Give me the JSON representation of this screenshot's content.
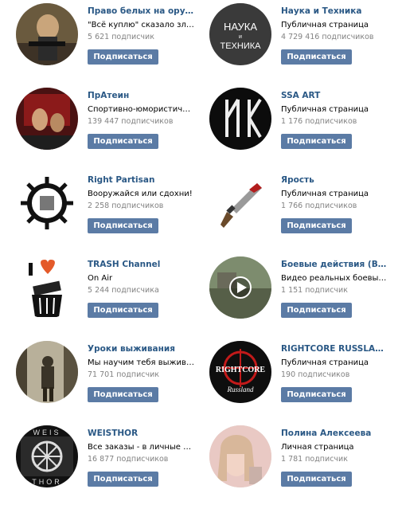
{
  "subscribe_label": "Подписаться",
  "groups": [
    {
      "name": "Право белых на оружие",
      "desc": "\"Всё куплю\" сказало злат…",
      "subs": "5 621 подписчик",
      "avatar": "gun-woman-avatar"
    },
    {
      "name": "Наука и Техника",
      "desc": "Публичная страница",
      "subs": "4 729 416 подписчиков",
      "avatar": "science-logo-avatar",
      "logo_top": "НАУКА",
      "logo_mid": "и",
      "logo_bottom": "ТЕХНИКА"
    },
    {
      "name": "ПрАтеин",
      "desc": "Спортивно-юмористическ…",
      "subs": "139 447 подписчиков",
      "avatar": "prathein-avatar"
    },
    {
      "name": "SSA ART",
      "desc": "Публичная страница",
      "subs": "1 176 подписчиков",
      "avatar": "ssa-runes-avatar"
    },
    {
      "name": "Right Partisan",
      "desc": "Вооружайся или сдохни!",
      "subs": "2 258 подписчиков",
      "avatar": "partisan-emblem-avatar"
    },
    {
      "name": "Ярость",
      "desc": "Публичная страница",
      "subs": "1 766 подписчиков",
      "avatar": "bloody-knife-avatar"
    },
    {
      "name": "TRASH Channel",
      "desc": "On Air",
      "subs": "5 244 подписчика",
      "avatar": "trash-tv-avatar"
    },
    {
      "name": "Боевые действия (Виде…",
      "desc": "Видео реальных боевых д…",
      "subs": "1 151 подписчик",
      "avatar": "battle-video-avatar"
    },
    {
      "name": "Уроки выживания",
      "desc": "Мы научим тебя выживать!",
      "subs": "71 701 подписчик",
      "avatar": "survivor-avatar"
    },
    {
      "name": "RIGHTCORE RUSSLAND",
      "desc": "Публичная страница",
      "subs": "190 подписчиков",
      "avatar": "rightcore-logo-avatar",
      "logo_top": "RIGHTCORE",
      "logo_bottom": "Russland"
    },
    {
      "name": "WEISTHOR",
      "desc": "Все заказы - в личные соо…",
      "subs": "16 877 подписчиков",
      "avatar": "weisthor-avatar",
      "logo_top": "WEIS",
      "logo_bottom": "THOR"
    },
    {
      "name": "Полина Алексеева",
      "desc": "Личная страница",
      "subs": "1 781 подписчик",
      "avatar": "person-photo-avatar"
    }
  ]
}
